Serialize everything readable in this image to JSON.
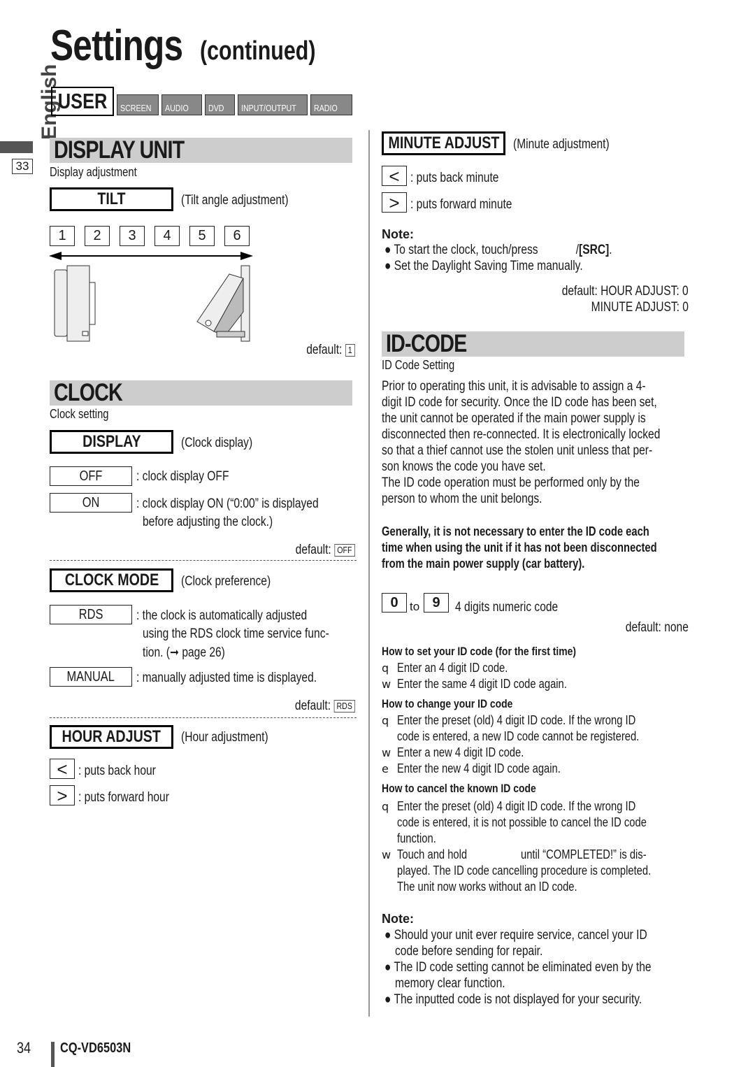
{
  "page": {
    "title": "Settings",
    "title_suffix": "(continued)",
    "language_tab": "English",
    "side_page_ref": "33",
    "page_number": "34",
    "model": "CQ-VD6503N"
  },
  "menu_tabs": {
    "active": "USER",
    "items": [
      "SCREEN",
      "AUDIO",
      "DVD",
      "INPUT/OUTPUT",
      "RADIO"
    ]
  },
  "display_unit": {
    "heading": "DISPLAY UNIT",
    "subtitle": "Display adjustment",
    "tilt": {
      "key": "TILT",
      "desc": "(Tilt angle adjustment)",
      "levels": [
        "1",
        "2",
        "3",
        "4",
        "5",
        "6"
      ],
      "default_label": "default:",
      "default_value": "1"
    }
  },
  "clock": {
    "heading": "CLOCK",
    "subtitle": "Clock setting",
    "display": {
      "key": "DISPLAY",
      "desc": "(Clock display)",
      "options": [
        {
          "value": "OFF",
          "desc": ": clock display OFF",
          "desc2": ""
        },
        {
          "value": "ON",
          "desc": ": clock display ON (“0:00” is displayed",
          "desc2": "before adjusting the clock.)"
        }
      ],
      "default_label": "default:",
      "default_value": "OFF"
    },
    "clock_mode": {
      "key": "CLOCK MODE",
      "desc": "(Clock preference)",
      "options": [
        {
          "value": "RDS",
          "desc": ": the clock is automatically adjusted",
          "desc2": "using the RDS clock time service func-",
          "desc3": "tion. (➞ page 26)"
        },
        {
          "value": "MANUAL",
          "desc": ": manually adjusted time is displayed."
        }
      ],
      "default_label": "default:",
      "default_value": "RDS"
    },
    "hour_adjust": {
      "key": "HOUR ADJUST",
      "desc": "(Hour adjustment)",
      "back_icon": "<",
      "back_desc": ": puts back hour",
      "forward_icon": ">",
      "forward_desc": ": puts forward hour"
    },
    "minute_adjust": {
      "key": "MINUTE ADJUST",
      "desc": "(Minute adjustment)",
      "back_icon": "<",
      "back_desc": ": puts back minute",
      "forward_icon": ">",
      "forward_desc": ": puts forward minute"
    },
    "note": {
      "heading": "Note:",
      "items": [
        {
          "text": "To start the clock, touch/press",
          "suffix_sep": "/",
          "suffix_bold": "[SRC]",
          "suffix_end": "."
        },
        {
          "text": "Set the Daylight Saving Time manually."
        }
      ]
    },
    "default_line1": "default: HOUR ADJUST: 0",
    "default_line2": "MINUTE ADJUST: 0"
  },
  "id_code": {
    "heading": "ID-CODE",
    "subtitle": "ID Code Setting",
    "intro": [
      "Prior to operating this unit, it is advisable to assign a 4-",
      "digit ID code for security. Once the ID code has been set,",
      "the unit cannot be operated if the main power supply is",
      "disconnected then re-connected. It is electronically locked",
      "so that a thief cannot use the stolen unit unless that per-",
      "son knows the code you have set.",
      "The ID code operation must be performed only by the",
      "person to whom the unit belongs."
    ],
    "bold_notice": [
      "Generally, it is not necessary to enter the ID code each",
      "time when using the unit if it has not been disconnected",
      "from the main power supply (car battery)."
    ],
    "range_from": "0",
    "range_to_word": "to",
    "range_to": "9",
    "range_desc": "4 digits numeric code",
    "default": "default: none",
    "set_first": {
      "heading": "How to set your ID code (for the first time)",
      "steps": [
        {
          "label": "q",
          "lines": [
            "Enter an 4 digit ID code."
          ]
        },
        {
          "label": "w",
          "lines": [
            "Enter the same 4 digit ID code again."
          ]
        }
      ]
    },
    "change": {
      "heading": "How to change your ID code",
      "steps": [
        {
          "label": "q",
          "lines": [
            "Enter the preset (old) 4 digit ID code. If the wrong ID",
            "code is entered, a new ID code cannot be registered."
          ]
        },
        {
          "label": "w",
          "lines": [
            "Enter a new 4 digit ID code."
          ]
        },
        {
          "label": "e",
          "lines": [
            "Enter the new 4 digit ID code again."
          ]
        }
      ]
    },
    "cancel": {
      "heading": "How to cancel the known ID code",
      "steps": [
        {
          "label": "q",
          "lines": [
            "Enter the preset (old) 4 digit ID code. If the wrong ID",
            "code is entered, it is not possible to cancel the ID code",
            "function."
          ]
        },
        {
          "label": "w",
          "lines": [
            "Touch and hold",
            "played. The ID code cancelling procedure is completed.",
            "The unit now works without an ID code."
          ],
          "line1_tail": "until “COMPLETED!” is dis-"
        }
      ]
    },
    "note": {
      "heading": "Note:",
      "items": [
        [
          "Should your unit ever require service, cancel your ID",
          "code before sending for repair."
        ],
        [
          "The ID code setting cannot be eliminated even by the",
          "memory clear function."
        ],
        [
          "The inputted code is not displayed for your security."
        ]
      ]
    }
  }
}
